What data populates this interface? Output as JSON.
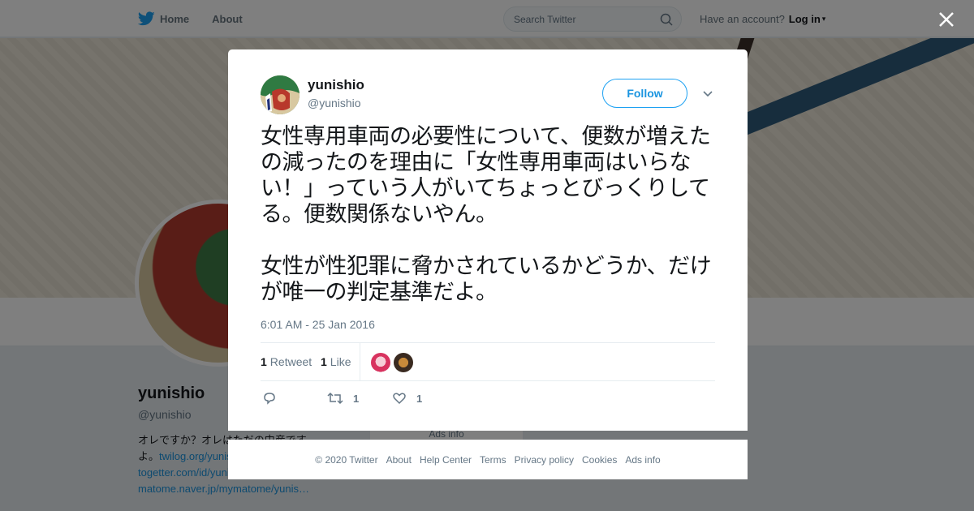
{
  "topbar": {
    "home_label": "Home",
    "about_label": "About",
    "search_placeholder": "Search Twitter",
    "have_account": "Have an account?",
    "login_label": "Log in"
  },
  "profile": {
    "name": "yunishio",
    "handle": "@yunishio",
    "bio_line1": "オレですか？オレはただの中産です",
    "bio_line2_prefix": "よ。",
    "bio_link1": "twilog.org/yunishio",
    "bio_link2": "togetter.com/id/yunishio",
    "bio_link3": "matome.naver.jp/mymatome/yunis…",
    "ads_info": "Ads info"
  },
  "tweet": {
    "user_name": "yunishio",
    "user_handle": "@yunishio",
    "follow_label": "Follow",
    "text": "女性専用車両の必要性について、便数が増えたの減ったのを理由に「女性専用車両はいらない！」っていう人がいてちょっとびっくりしてる。便数関係ないやん。\n\n女性が性犯罪に脅かされているかどうか、だけが唯一の判定基準だよ。",
    "date": "6:01 AM - 25 Jan 2016",
    "retweet_count": "1",
    "retweet_label": "Retweet",
    "like_count": "1",
    "like_label": "Like",
    "action_retweet_count": "1",
    "action_like_count": "1"
  },
  "footer": {
    "links": [
      "© 2020 Twitter",
      "About",
      "Help Center",
      "Terms",
      "Privacy policy",
      "Cookies",
      "Ads info"
    ]
  },
  "colors": {
    "twitter_blue": "#1da1f2",
    "link_blue": "#1b95e0",
    "muted": "#657786"
  },
  "icons": [
    "twitter-bird-icon",
    "search-icon",
    "close-icon",
    "chevron-down-icon",
    "reply-icon",
    "retweet-icon",
    "heart-icon"
  ]
}
